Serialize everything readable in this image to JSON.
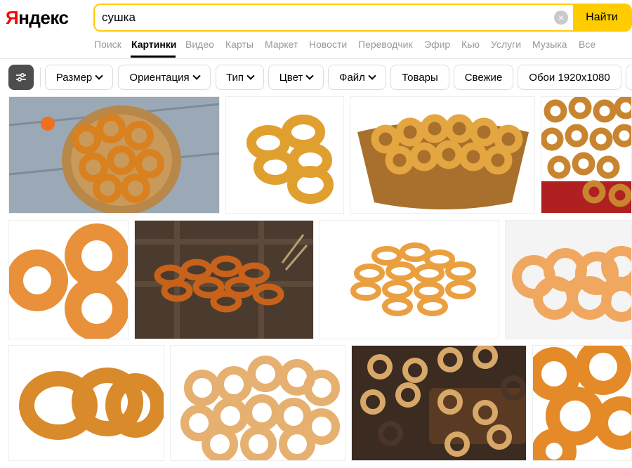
{
  "logo": {
    "first": "Я",
    "rest": "ндекс"
  },
  "search": {
    "value": "сушка",
    "clear_glyph": "×",
    "button_label": "Найти"
  },
  "nav": {
    "tabs": [
      {
        "label": "Поиск",
        "active": false
      },
      {
        "label": "Картинки",
        "active": true
      },
      {
        "label": "Видео",
        "active": false
      },
      {
        "label": "Карты",
        "active": false
      },
      {
        "label": "Маркет",
        "active": false
      },
      {
        "label": "Новости",
        "active": false
      },
      {
        "label": "Переводчик",
        "active": false
      },
      {
        "label": "Эфир",
        "active": false
      },
      {
        "label": "Кью",
        "active": false
      },
      {
        "label": "Услуги",
        "active": false
      },
      {
        "label": "Музыка",
        "active": false
      },
      {
        "label": "Все",
        "active": false
      }
    ]
  },
  "filters": {
    "chips": [
      {
        "label": "Размер",
        "dropdown": true
      },
      {
        "label": "Ориентация",
        "dropdown": true
      },
      {
        "label": "Тип",
        "dropdown": true
      },
      {
        "label": "Цвет",
        "dropdown": true
      },
      {
        "label": "Файл",
        "dropdown": true
      },
      {
        "label": "Товары",
        "dropdown": false
      },
      {
        "label": "Свежие",
        "dropdown": false
      },
      {
        "label": "Обои 1920x1080",
        "dropdown": false
      }
    ]
  },
  "colors": {
    "accent": "#ffcc00",
    "logo_red": "#ff0000",
    "bagel": "#d98a2b",
    "bagel_dark": "#a85a14"
  }
}
